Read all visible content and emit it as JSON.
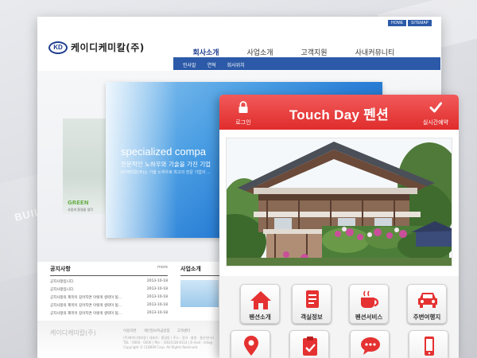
{
  "background": {
    "watermark": "BUIL"
  },
  "desktop": {
    "topbar": {
      "home": "HOME",
      "sitemap": "SITEMAP"
    },
    "logo": {
      "mark": "KD",
      "name": "케이디케미칼(주)"
    },
    "nav": [
      "회사소개",
      "사업소개",
      "고객지원",
      "사내커뮤니티"
    ],
    "subnav": [
      "인사말",
      "연혁",
      "회사위치"
    ],
    "hero": {
      "title": "specialized compa",
      "subtitle": "전문적인 노하우와 기술을 가진 기업",
      "small": "KD케미칼(주)는 기술 노하우로 최고의 전문 기업이 ..."
    },
    "left_photo": {
      "title": "GREEN",
      "caption": "사람과 환경을 생각"
    },
    "notice": {
      "heading": "공지사항",
      "more": "more",
      "rows": [
        {
          "title": "공지사항입니다.",
          "date": "2013-10-18"
        },
        {
          "title": "공지사항입니다.",
          "date": "2013-10-18"
        },
        {
          "title": "공지사항의 제목이 길어지면 이렇게 생략이 됨...",
          "date": "2013-10-18"
        },
        {
          "title": "공지사항의 제목이 길어지면 이렇게 생략이 됨...",
          "date": "2013-10-18"
        },
        {
          "title": "공지사항의 제목이 길어지면 이렇게 생략이 됨...",
          "date": "2013-10-18"
        }
      ]
    },
    "business": {
      "heading": "사업소개"
    },
    "footer": {
      "name": "케이디케미칼(주)",
      "links": [
        "이용약관",
        "개인정보취급방침",
        "고객센터"
      ],
      "info1": "(주)케이디케미칼  |  대표자 : 홍길동  |  주소 : 경기 · 충청 · 울산(본사)",
      "info2": "TEL : 0000 - 0000  |  팩스 : (002)138-8114  |  E-mail : info@",
      "info3": "Copyright © CLIBEM Corp. All Rights Reserved."
    }
  },
  "mobile": {
    "title": "Touch Day 펜션",
    "login": "로그인",
    "reserve": "실시간예약",
    "menu": [
      {
        "label": "펜션소개",
        "icon": "house-icon"
      },
      {
        "label": "객실정보",
        "icon": "document-icon"
      },
      {
        "label": "펜션서비스",
        "icon": "coffee-cup-icon"
      },
      {
        "label": "주변여행지",
        "icon": "car-icon"
      },
      {
        "label": "",
        "icon": "map-pin-icon"
      },
      {
        "label": "",
        "icon": "clipboard-check-icon"
      },
      {
        "label": "",
        "icon": "chat-bubble-icon"
      },
      {
        "label": "",
        "icon": "smartphone-icon"
      }
    ],
    "accent": "#e53131"
  }
}
